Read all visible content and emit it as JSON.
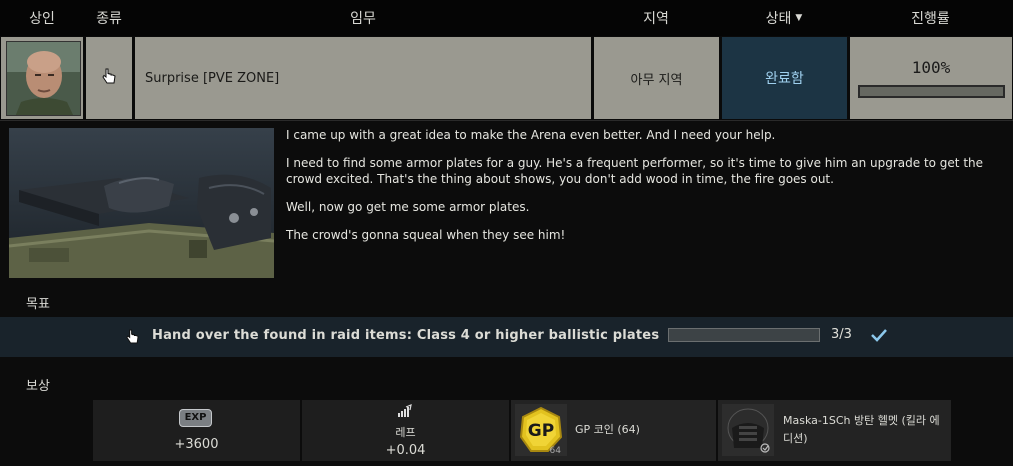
{
  "header": {
    "trader": "상인",
    "type": "종류",
    "task": "임무",
    "location": "지역",
    "status": "상태",
    "progress": "진행률"
  },
  "quest": {
    "name": "Surprise [PVE ZONE]",
    "location": "아무 지역",
    "status": "완료함",
    "progress_text": "100%",
    "progress_fraction": 1.0,
    "type_icon": "hand-pointer-icon"
  },
  "description": [
    "I came up with a great idea to make the Arena even better. And I need your help.",
    "I need to find some armor plates for a guy. He's a frequent performer, so it's time to give him an upgrade to get the crowd excited. That's the thing about shows, you don't add wood in time, the fire goes out.",
    "Well, now go get me some armor plates.",
    "The crowd's gonna squeal when they see him!"
  ],
  "objectives_label": "목표",
  "objective": {
    "text": "Hand over the found in raid items: Class 4 or higher ballistic plates",
    "count": "3/3",
    "progress_fraction": 1.0
  },
  "rewards_label": "보상",
  "rewards": {
    "exp_icon_text": "EXP",
    "exp_value": "+3600",
    "rep_label": "레프",
    "rep_value": "+0.04",
    "gp_icon_text": "GP",
    "gp_count_badge": "64",
    "gp_label": "GP 코인 (64)",
    "helmet_label": "Maska-1SCh 방탄 헬멧 (킬라 에디션)"
  },
  "colors": {
    "status_bg": "#1c3444",
    "status_text": "#9fd0ee",
    "row_bg": "#9a9990",
    "objective_bg": "#19232b",
    "check": "#8cc8ec"
  }
}
